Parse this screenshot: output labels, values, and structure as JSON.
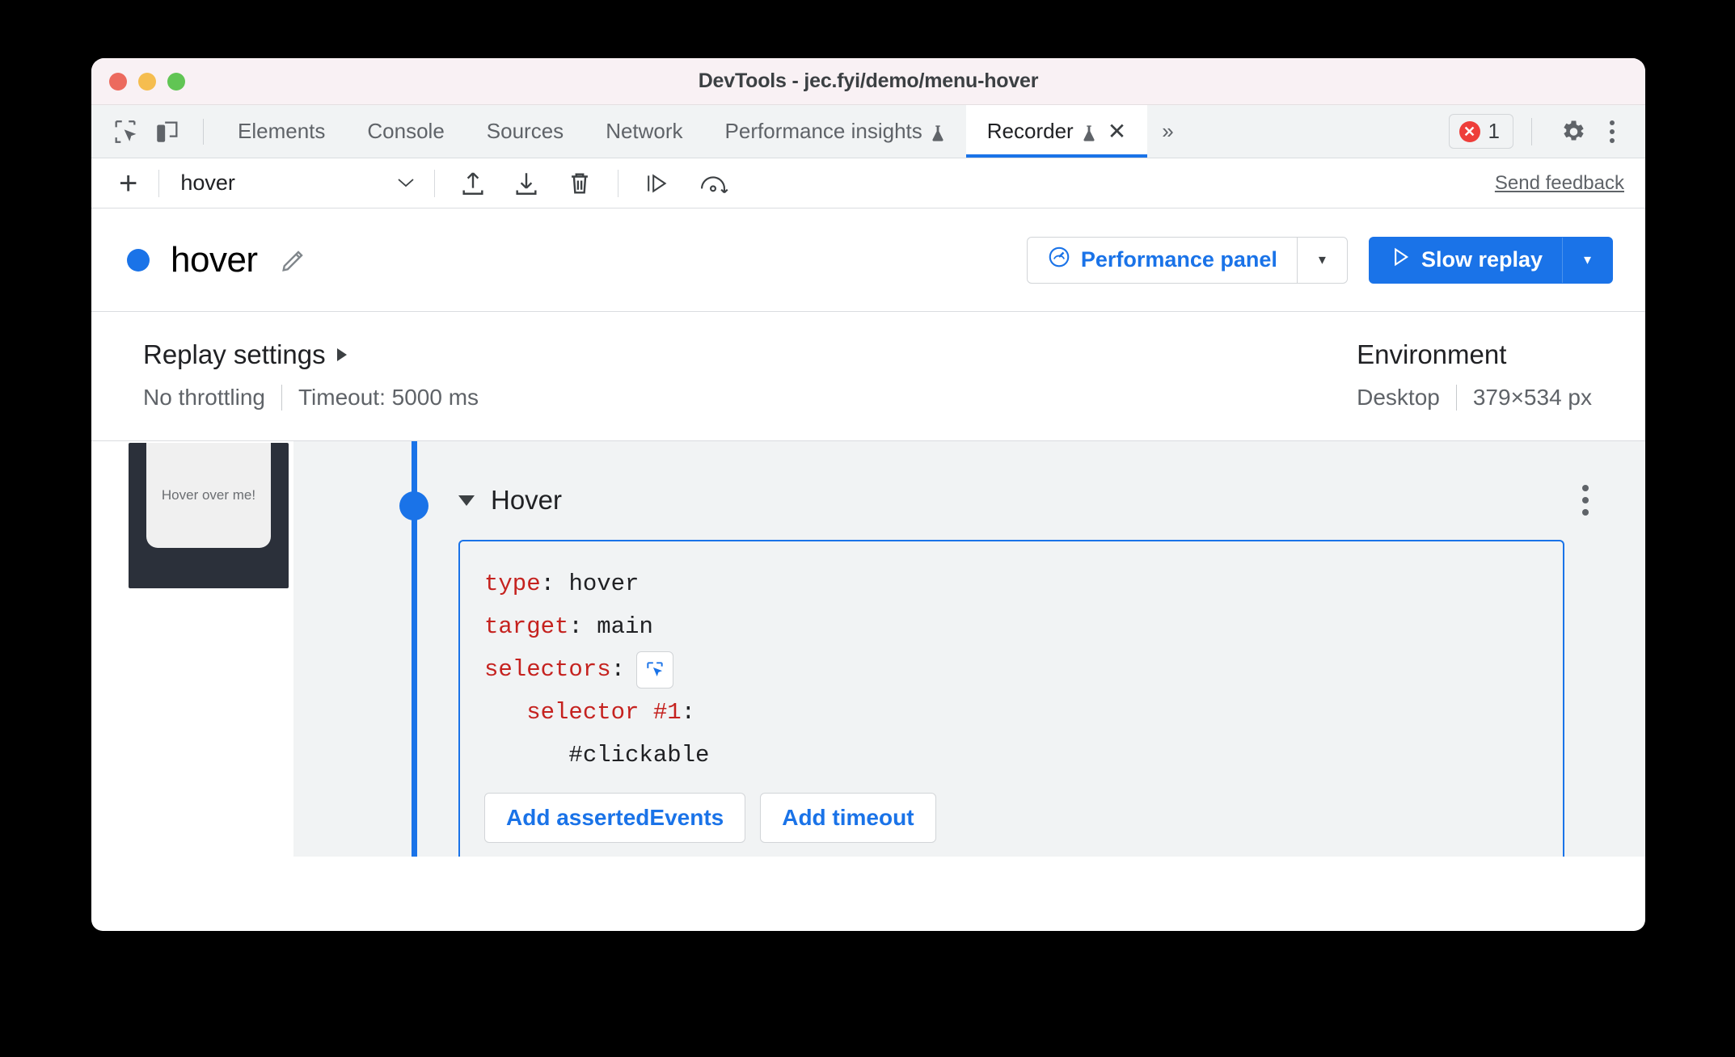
{
  "window": {
    "title": "DevTools - jec.fyi/demo/menu-hover",
    "traffic_lights": [
      "close",
      "minimize",
      "zoom"
    ]
  },
  "tabbar": {
    "inspect_icon": "inspect-element-icon",
    "device_icon": "device-toolbar-icon",
    "tabs": [
      {
        "label": "Elements",
        "active": false,
        "experimental": false,
        "closable": false
      },
      {
        "label": "Console",
        "active": false,
        "experimental": false,
        "closable": false
      },
      {
        "label": "Sources",
        "active": false,
        "experimental": false,
        "closable": false
      },
      {
        "label": "Network",
        "active": false,
        "experimental": false,
        "closable": false
      },
      {
        "label": "Performance insights",
        "active": false,
        "experimental": true,
        "closable": false
      },
      {
        "label": "Recorder",
        "active": true,
        "experimental": true,
        "closable": true
      }
    ],
    "more_tabs": "»",
    "error_count": "1",
    "error_glyph": "✕",
    "settings_icon": "gear-icon",
    "more_options_icon": "kebab-menu-icon"
  },
  "recorder_toolbar": {
    "add_label": "+",
    "recording_name": "hover",
    "select_caret": "∨",
    "import_icon": "import-recording-icon",
    "export_icon": "export-recording-icon",
    "delete_icon": "delete-recording-icon",
    "step_icon": "step-over-icon",
    "replay_icon": "replay-icon",
    "feedback_label": "Send feedback"
  },
  "recording_header": {
    "status_dot_color": "#1a73e8",
    "title": "hover",
    "edit_icon": "pencil-edit-icon",
    "perf_button": {
      "label": "Performance panel",
      "icon": "performance-gauge-icon",
      "caret": "▾"
    },
    "replay_button": {
      "label": "Slow replay",
      "icon": "play-triangle-icon",
      "caret": "▾"
    }
  },
  "settings": {
    "replay": {
      "title": "Replay settings",
      "expand_caret": "▶",
      "throttling": "No throttling",
      "timeout": "Timeout: 5000 ms"
    },
    "environment": {
      "title": "Environment",
      "device": "Desktop",
      "viewport": "379×534 px"
    }
  },
  "steps": {
    "thumbnail_caption": "Hover over me!",
    "step": {
      "collapse_caret": "▼",
      "title": "Hover",
      "menu_icon": "step-kebab-menu-icon",
      "code": {
        "type_key": "type",
        "type_sep": ": ",
        "type_value": "hover",
        "target_key": "target",
        "target_sep": ": ",
        "target_value": "main",
        "selectors_key": "selectors",
        "selectors_sep": ":",
        "picker_icon": "selector-picker-icon",
        "selector_label": "   selector #1",
        "selector_sep": ":",
        "selector_value": "      #clickable"
      },
      "actions": [
        {
          "label": "Add assertedEvents"
        },
        {
          "label": "Add timeout"
        }
      ]
    }
  },
  "colors": {
    "accent": "#1a73e8",
    "error": "#ee3e3a",
    "code_key": "#c5221f",
    "panel_bg": "#f1f3f4",
    "titlebar_bg": "#f9f1f4"
  }
}
